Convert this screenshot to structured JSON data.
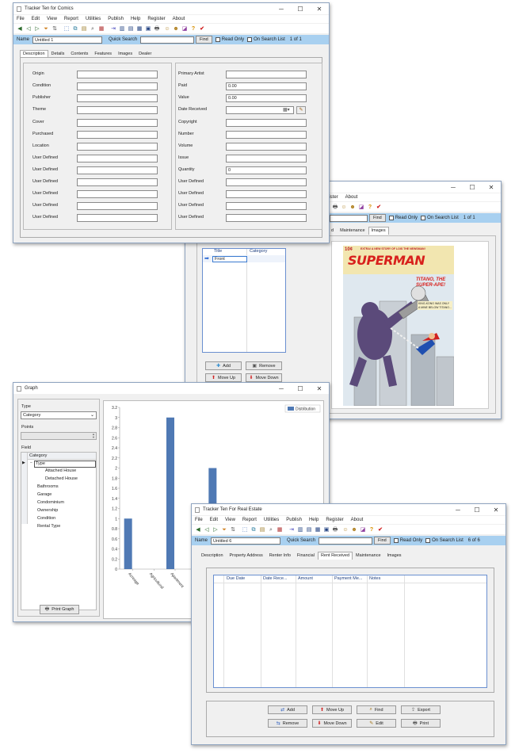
{
  "comics": {
    "title": "Tracker Ten for Comics",
    "menu": [
      "File",
      "Edit",
      "View",
      "Report",
      "Utilities",
      "Publish",
      "Help",
      "Register",
      "About"
    ],
    "infobar": {
      "name_label": "Name",
      "name_value": "Untitled 1",
      "quick_search": "Quick Search",
      "find": "Find",
      "read_only": "Read Only",
      "on_search_list": "On Search List",
      "record": "1 of 1"
    },
    "tabs": [
      "Description",
      "Details",
      "Contents",
      "Features",
      "Images",
      "Dealer"
    ],
    "left_fields": [
      {
        "label": "Origin",
        "value": ""
      },
      {
        "label": "Condition",
        "value": ""
      },
      {
        "label": "Publisher",
        "value": ""
      },
      {
        "label": "Theme",
        "value": ""
      },
      {
        "label": "Cover",
        "value": ""
      },
      {
        "label": "Purchased",
        "value": ""
      },
      {
        "label": "Location",
        "value": ""
      },
      {
        "label": "User Defined",
        "value": ""
      },
      {
        "label": "User Defined",
        "value": ""
      },
      {
        "label": "User Defined",
        "value": ""
      },
      {
        "label": "User Defined",
        "value": ""
      },
      {
        "label": "User Defined",
        "value": ""
      },
      {
        "label": "User Defined",
        "value": ""
      }
    ],
    "right_fields": [
      {
        "label": "Primary Artist",
        "value": ""
      },
      {
        "label": "Paid",
        "value": "0.00"
      },
      {
        "label": "Value",
        "value": "0.00"
      },
      {
        "label": "Date Received",
        "value": ""
      },
      {
        "label": "Copyright",
        "value": ""
      },
      {
        "label": "Number",
        "value": ""
      },
      {
        "label": "Volume",
        "value": ""
      },
      {
        "label": "Issue",
        "value": ""
      },
      {
        "label": "Quantity",
        "value": "0"
      },
      {
        "label": "User Defined",
        "value": ""
      },
      {
        "label": "User Defined",
        "value": ""
      },
      {
        "label": "User Defined",
        "value": ""
      },
      {
        "label": "User Defined",
        "value": ""
      }
    ]
  },
  "images_window": {
    "menu": [
      "gister",
      "About"
    ],
    "find": "Find",
    "read_only": "Read Only",
    "on_search_list": "On Search List",
    "record": "1 of 1",
    "tabs": [
      "d",
      "Maintenance",
      "Images"
    ],
    "list_headers": [
      "Title",
      "Category"
    ],
    "list_rows": [
      {
        "title": "Front",
        "category": ""
      }
    ],
    "buttons": {
      "add": "Add",
      "remove": "Remove",
      "move_up": "Move Up",
      "move_down": "Move Down"
    },
    "cover": {
      "brand": "SUPERMAN",
      "headline": "TITANO, THE SUPER-APE!",
      "teaser": "EXTRA! A NEW STORY OF LOIS THE NEWSMAN!",
      "caption": "KING-KONG WAS ONLY A MINE BELOW TITANO...",
      "price": "10¢"
    }
  },
  "graph": {
    "title": "Graph",
    "type_label": "Type",
    "type_value": "Category",
    "points_label": "Points",
    "field_label": "Field",
    "tree": [
      "Category",
      "Type",
      "Attached House",
      "Detached House",
      "Bathrooms",
      "Garage",
      "Condominium",
      "Ownership",
      "Condition",
      "Rental Type"
    ],
    "print_button": "Print Graph"
  },
  "chart_data": {
    "type": "bar",
    "categories": [
      "Acreage",
      "Agricultural",
      "Apartment",
      "Attached House",
      "Detached House",
      "Mobile"
    ],
    "series": [
      {
        "name": "Distribution",
        "values": [
          1,
          0,
          3,
          0,
          2,
          0
        ]
      }
    ],
    "ylim": [
      0,
      3.2
    ],
    "yticks": [
      "0",
      "0.2",
      "0.4",
      "0.6",
      "0.8",
      "1",
      "1.2",
      "1.4",
      "1.6",
      "1.8",
      "2",
      "2.2",
      "2.4",
      "2.6",
      "2.8",
      "3",
      "3.2"
    ],
    "legend_position": "top-right",
    "bar_color": "#4f79b4"
  },
  "realestate": {
    "title": "Tracker Ten For Real Estate",
    "menu": [
      "File",
      "Edit",
      "View",
      "Report",
      "Utilities",
      "Publish",
      "Help",
      "Register",
      "About"
    ],
    "infobar": {
      "name_label": "Name",
      "name_value": "Untitled 6",
      "quick_search": "Quick Search",
      "find": "Find",
      "read_only": "Read Only",
      "on_search_list": "On Search List",
      "record": "6 of 6"
    },
    "tabs": [
      "Description",
      "Property Address",
      "Renter Info",
      "Financial",
      "Rent Received",
      "Maintenance",
      "Images"
    ],
    "grid_headers": [
      "Due Date",
      "Date Rece...",
      "Amount",
      "Payment Me...",
      "Notes"
    ],
    "buttons": {
      "add": "Add",
      "move_up": "Move Up",
      "find": "Find",
      "export": "Export",
      "remove": "Remove",
      "move_down": "Move Down",
      "edit": "Edit",
      "print": "Print"
    }
  },
  "colors": {
    "accent": "#a8d0f0",
    "selection": "#0078d7",
    "list_border": "#6a8fd0"
  }
}
